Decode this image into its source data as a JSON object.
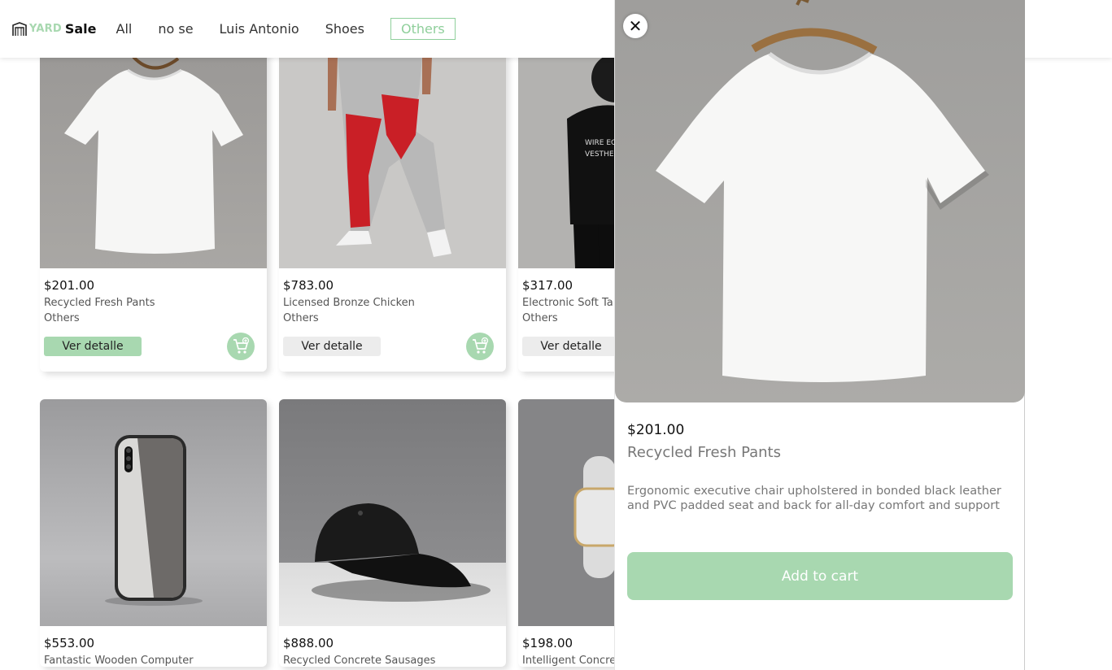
{
  "brand": {
    "yard": "YARD",
    "sale": "Sale"
  },
  "nav": {
    "items": [
      "All",
      "no se",
      "Luis Antonio",
      "Shoes"
    ],
    "active": "Others"
  },
  "colors": {
    "accent": "#a8d8b0",
    "accent_text": "#8fcf9b",
    "muted_text": "#777777"
  },
  "products": [
    {
      "price": "$201.00",
      "name": "Recycled Fresh Pants",
      "category": "Others",
      "detail": "Ver detalle",
      "image": "white-tshirt"
    },
    {
      "price": "$783.00",
      "name": "Licensed Bronze Chicken",
      "category": "Others",
      "detail": "Ver detalle",
      "image": "red-grey-pants"
    },
    {
      "price": "$317.00",
      "name": "Electronic Soft Ta",
      "category": "Others",
      "detail": "Ver detalle",
      "image": "black-tshirt-model"
    },
    {
      "price": "$553.00",
      "name": "Fantastic Wooden Computer",
      "image": "phone"
    },
    {
      "price": "$888.00",
      "name": "Recycled Concrete Sausages",
      "image": "black-cap"
    },
    {
      "price": "$198.00",
      "name": "Intelligent Concre",
      "image": "white-watch"
    }
  ],
  "detail_panel": {
    "close": "✕",
    "price": "$201.00",
    "name": "Recycled Fresh Pants",
    "description": "Ergonomic executive chair upholstered in bonded black leather and PVC padded seat and back for all-day comfort and support",
    "add_to_cart": "Add to cart",
    "image": "white-tshirt-hanger"
  }
}
